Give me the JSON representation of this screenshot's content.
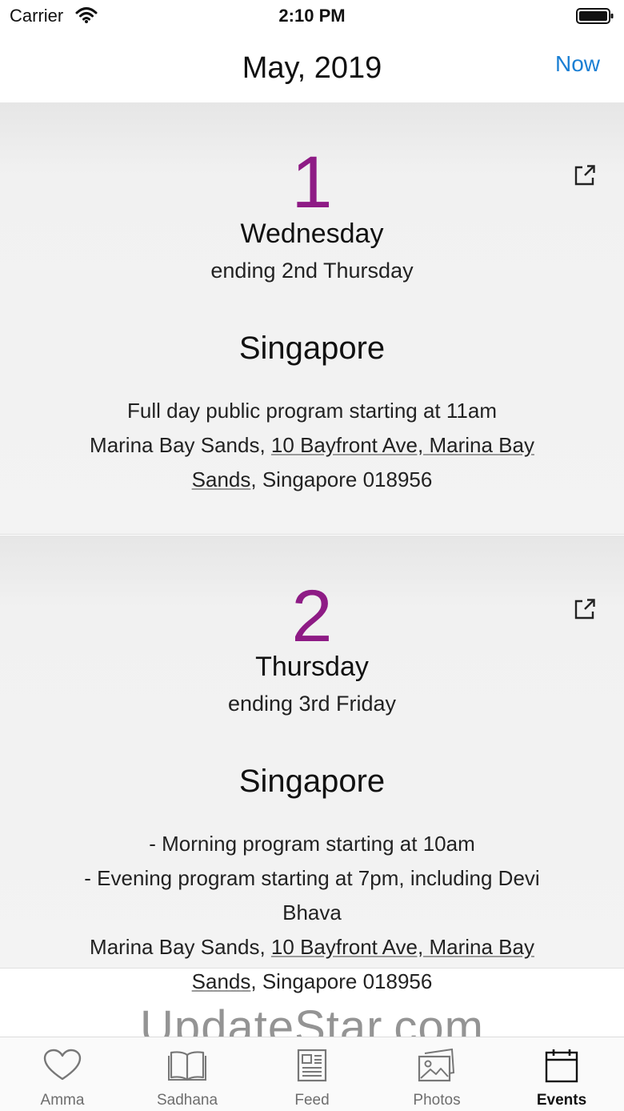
{
  "status_bar": {
    "carrier": "Carrier",
    "time": "2:10 PM"
  },
  "nav": {
    "title": "May, 2019",
    "now_label": "Now"
  },
  "events": [
    {
      "day": "1",
      "weekday": "Wednesday",
      "ending": "ending 2nd Thursday",
      "city": "Singapore",
      "lines": [
        "Full day public program starting at 11am"
      ],
      "venue": "Marina Bay Sands, ",
      "address_line1": "10 Bayfront Ave, Marina Bay",
      "address_line2": "Sands",
      "address_tail": ", Singapore 018956"
    },
    {
      "day": "2",
      "weekday": "Thursday",
      "ending": "ending 3rd Friday",
      "city": "Singapore",
      "lines": [
        "- Morning program starting at 10am",
        "- Evening program starting at 7pm, including Devi",
        "Bhava"
      ],
      "venue": "Marina Bay Sands, ",
      "address_line1": "10 Bayfront Ave, Marina Bay",
      "address_line2": "Sands",
      "address_tail": ", Singapore 018956"
    }
  ],
  "watermark": "UpdateStar.com",
  "tabs": [
    {
      "label": "Amma",
      "icon": "heart-icon"
    },
    {
      "label": "Sadhana",
      "icon": "book-icon"
    },
    {
      "label": "Feed",
      "icon": "newspaper-icon"
    },
    {
      "label": "Photos",
      "icon": "photos-icon"
    },
    {
      "label": "Events",
      "icon": "calendar-icon",
      "active": true
    }
  ],
  "colors": {
    "accent": "#8e1b85",
    "link": "#1a7fd4"
  }
}
